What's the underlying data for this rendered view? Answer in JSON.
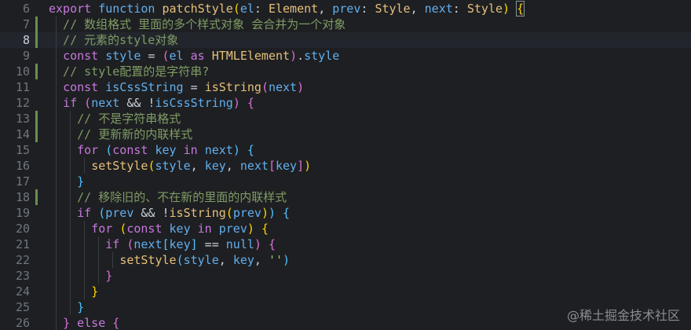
{
  "editor": {
    "lines": [
      {
        "n": "6",
        "segs": [
          [
            "k",
            "export "
          ],
          [
            "kb",
            "function "
          ],
          [
            "fn",
            "patchStyle"
          ],
          [
            "b1",
            "("
          ],
          [
            "v",
            "el"
          ],
          [
            "p",
            ": "
          ],
          [
            "ty",
            "Element"
          ],
          [
            "p",
            ", "
          ],
          [
            "v",
            "prev"
          ],
          [
            "p",
            ": "
          ],
          [
            "ty",
            "Style"
          ],
          [
            "p",
            ", "
          ],
          [
            "v",
            "next"
          ],
          [
            "p",
            ": "
          ],
          [
            "ty",
            "Style"
          ],
          [
            "b1",
            ")"
          ],
          [
            "p",
            " "
          ],
          [
            "b1",
            "{"
          ]
        ]
      },
      {
        "n": "7",
        "segs": [
          [
            "c",
            "  // 数组格式 里面的多个样式对象 会合并为一个对象"
          ]
        ]
      },
      {
        "n": "8",
        "segs": [
          [
            "c",
            "  // 元素的style对象"
          ]
        ]
      },
      {
        "n": "9",
        "segs": [
          [
            "p",
            "  "
          ],
          [
            "k",
            "const "
          ],
          [
            "v",
            "style"
          ],
          [
            "p",
            " = "
          ],
          [
            "b2",
            "("
          ],
          [
            "v",
            "el"
          ],
          [
            "k",
            " as "
          ],
          [
            "ty",
            "HTMLElement"
          ],
          [
            "b2",
            ")"
          ],
          [
            "p",
            "."
          ],
          [
            "v",
            "style"
          ]
        ]
      },
      {
        "n": "10",
        "segs": [
          [
            "c",
            "  // style配置的是字符串?"
          ]
        ]
      },
      {
        "n": "11",
        "segs": [
          [
            "p",
            "  "
          ],
          [
            "k",
            "const "
          ],
          [
            "v",
            "isCssString"
          ],
          [
            "p",
            " = "
          ],
          [
            "fn2",
            "isString"
          ],
          [
            "b2",
            "("
          ],
          [
            "v",
            "next"
          ],
          [
            "b2",
            ")"
          ]
        ]
      },
      {
        "n": "12",
        "segs": [
          [
            "p",
            "  "
          ],
          [
            "k",
            "if "
          ],
          [
            "b2",
            "("
          ],
          [
            "v",
            "next"
          ],
          [
            "p",
            " && !"
          ],
          [
            "v",
            "isCssString"
          ],
          [
            "b2",
            ")"
          ],
          [
            "p",
            " "
          ],
          [
            "b2",
            "{"
          ]
        ]
      },
      {
        "n": "13",
        "segs": [
          [
            "c",
            "    // 不是字符串格式"
          ]
        ]
      },
      {
        "n": "14",
        "segs": [
          [
            "c",
            "    // 更新新的内联样式"
          ]
        ]
      },
      {
        "n": "15",
        "segs": [
          [
            "p",
            "    "
          ],
          [
            "k",
            "for "
          ],
          [
            "b3",
            "("
          ],
          [
            "k",
            "const "
          ],
          [
            "v",
            "key"
          ],
          [
            "k",
            " in "
          ],
          [
            "v",
            "next"
          ],
          [
            "b3",
            ")"
          ],
          [
            "p",
            " "
          ],
          [
            "b3",
            "{"
          ]
        ]
      },
      {
        "n": "16",
        "segs": [
          [
            "p",
            "      "
          ],
          [
            "fn2",
            "setStyle"
          ],
          [
            "b1",
            "("
          ],
          [
            "v",
            "style"
          ],
          [
            "p",
            ", "
          ],
          [
            "v",
            "key"
          ],
          [
            "p",
            ", "
          ],
          [
            "v",
            "next"
          ],
          [
            "b2",
            "["
          ],
          [
            "v",
            "key"
          ],
          [
            "b2",
            "]"
          ],
          [
            "b1",
            ")"
          ]
        ]
      },
      {
        "n": "17",
        "segs": [
          [
            "p",
            "    "
          ],
          [
            "b3",
            "}"
          ]
        ]
      },
      {
        "n": "18",
        "segs": [
          [
            "c",
            "    // 移除旧的、不在新的里面的内联样式"
          ]
        ]
      },
      {
        "n": "19",
        "segs": [
          [
            "p",
            "    "
          ],
          [
            "k",
            "if "
          ],
          [
            "b3",
            "("
          ],
          [
            "v",
            "prev"
          ],
          [
            "p",
            " && !"
          ],
          [
            "fn2",
            "isString"
          ],
          [
            "b1",
            "("
          ],
          [
            "v",
            "prev"
          ],
          [
            "b1",
            ")"
          ],
          [
            "b3",
            ")"
          ],
          [
            "p",
            " "
          ],
          [
            "b3",
            "{"
          ]
        ]
      },
      {
        "n": "20",
        "segs": [
          [
            "p",
            "      "
          ],
          [
            "k",
            "for "
          ],
          [
            "b1",
            "("
          ],
          [
            "k",
            "const "
          ],
          [
            "v",
            "key"
          ],
          [
            "k",
            " in "
          ],
          [
            "v",
            "prev"
          ],
          [
            "b1",
            ")"
          ],
          [
            "p",
            " "
          ],
          [
            "b1",
            "{"
          ]
        ]
      },
      {
        "n": "21",
        "segs": [
          [
            "p",
            "        "
          ],
          [
            "k",
            "if "
          ],
          [
            "b2",
            "("
          ],
          [
            "v",
            "next"
          ],
          [
            "b3",
            "["
          ],
          [
            "v",
            "key"
          ],
          [
            "b3",
            "]"
          ],
          [
            "p",
            " == "
          ],
          [
            "kb",
            "null"
          ],
          [
            "b2",
            ")"
          ],
          [
            "p",
            " "
          ],
          [
            "b2",
            "{"
          ]
        ]
      },
      {
        "n": "22",
        "segs": [
          [
            "p",
            "          "
          ],
          [
            "fn2",
            "setStyle"
          ],
          [
            "b3",
            "("
          ],
          [
            "v",
            "style"
          ],
          [
            "p",
            ", "
          ],
          [
            "v",
            "key"
          ],
          [
            "p",
            ", "
          ],
          [
            "s",
            "''"
          ],
          [
            "b3",
            ")"
          ]
        ]
      },
      {
        "n": "23",
        "segs": [
          [
            "p",
            "        "
          ],
          [
            "b2",
            "}"
          ]
        ]
      },
      {
        "n": "24",
        "segs": [
          [
            "p",
            "      "
          ],
          [
            "b1",
            "}"
          ]
        ]
      },
      {
        "n": "25",
        "segs": [
          [
            "p",
            "    "
          ],
          [
            "b3",
            "}"
          ]
        ]
      },
      {
        "n": "26",
        "segs": [
          [
            "p",
            "  "
          ],
          [
            "b2",
            "}"
          ],
          [
            "k",
            " else "
          ],
          [
            "b2",
            "{"
          ]
        ]
      }
    ],
    "active_line": "8",
    "modified_lines": [
      "7",
      "8",
      "10",
      "13",
      "14",
      "18"
    ]
  },
  "watermark": "@稀土掘金技术社区"
}
